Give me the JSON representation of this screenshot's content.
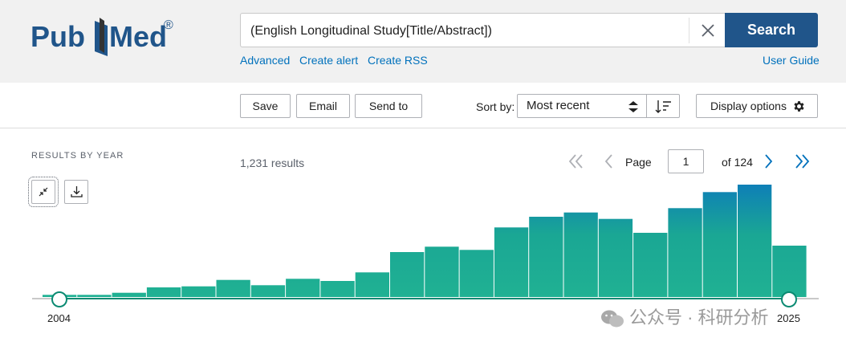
{
  "app": {
    "logo_text": "PubMed",
    "registered_mark": "®"
  },
  "search": {
    "value": "(English Longitudinal Study[Title/Abstract])",
    "button_label": "Search",
    "links": [
      "Advanced",
      "Create alert",
      "Create RSS"
    ],
    "user_guide": "User Guide"
  },
  "toolbar": {
    "save": "Save",
    "email": "Email",
    "send_to": "Send to",
    "sort_label": "Sort by:",
    "sort_value": "Most recent",
    "display_options": "Display options"
  },
  "results": {
    "by_year_label": "RESULTS BY YEAR",
    "count_text": "1,231 results",
    "page_label": "Page",
    "page_value": "1",
    "of_pages": "of 124"
  },
  "chart_data": {
    "type": "bar",
    "categories": [
      "2004",
      "2005",
      "2006",
      "2007",
      "2008",
      "2009",
      "2010",
      "2011",
      "2012",
      "2013",
      "2014",
      "2015",
      "2016",
      "2017",
      "2018",
      "2019",
      "2020",
      "2021",
      "2022",
      "2023",
      "2024",
      "2025"
    ],
    "values": [
      2,
      2,
      4,
      9,
      10,
      16,
      11,
      17,
      15,
      23,
      42,
      47,
      44,
      65,
      75,
      79,
      73,
      60,
      83,
      98,
      105,
      48
    ],
    "range_start_label": "2004",
    "range_end_label": "2025",
    "bar_color_bottom": "#20b193",
    "bar_color_top": "#0e7fb7"
  },
  "watermark": "公众号 · 科研分析",
  "colors": {
    "accent": "#20558a",
    "link": "#0071bc",
    "slider": "#0b8a72"
  }
}
